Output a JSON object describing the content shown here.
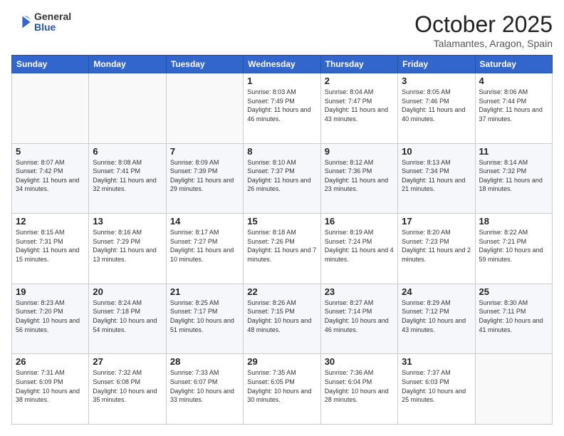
{
  "header": {
    "logo_general": "General",
    "logo_blue": "Blue",
    "month": "October 2025",
    "location": "Talamantes, Aragon, Spain"
  },
  "days_of_week": [
    "Sunday",
    "Monday",
    "Tuesday",
    "Wednesday",
    "Thursday",
    "Friday",
    "Saturday"
  ],
  "weeks": [
    [
      {
        "day": "",
        "info": ""
      },
      {
        "day": "",
        "info": ""
      },
      {
        "day": "",
        "info": ""
      },
      {
        "day": "1",
        "info": "Sunrise: 8:03 AM\nSunset: 7:49 PM\nDaylight: 11 hours and 46 minutes."
      },
      {
        "day": "2",
        "info": "Sunrise: 8:04 AM\nSunset: 7:47 PM\nDaylight: 11 hours and 43 minutes."
      },
      {
        "day": "3",
        "info": "Sunrise: 8:05 AM\nSunset: 7:46 PM\nDaylight: 11 hours and 40 minutes."
      },
      {
        "day": "4",
        "info": "Sunrise: 8:06 AM\nSunset: 7:44 PM\nDaylight: 11 hours and 37 minutes."
      }
    ],
    [
      {
        "day": "5",
        "info": "Sunrise: 8:07 AM\nSunset: 7:42 PM\nDaylight: 11 hours and 34 minutes."
      },
      {
        "day": "6",
        "info": "Sunrise: 8:08 AM\nSunset: 7:41 PM\nDaylight: 11 hours and 32 minutes."
      },
      {
        "day": "7",
        "info": "Sunrise: 8:09 AM\nSunset: 7:39 PM\nDaylight: 11 hours and 29 minutes."
      },
      {
        "day": "8",
        "info": "Sunrise: 8:10 AM\nSunset: 7:37 PM\nDaylight: 11 hours and 26 minutes."
      },
      {
        "day": "9",
        "info": "Sunrise: 8:12 AM\nSunset: 7:36 PM\nDaylight: 11 hours and 23 minutes."
      },
      {
        "day": "10",
        "info": "Sunrise: 8:13 AM\nSunset: 7:34 PM\nDaylight: 11 hours and 21 minutes."
      },
      {
        "day": "11",
        "info": "Sunrise: 8:14 AM\nSunset: 7:32 PM\nDaylight: 11 hours and 18 minutes."
      }
    ],
    [
      {
        "day": "12",
        "info": "Sunrise: 8:15 AM\nSunset: 7:31 PM\nDaylight: 11 hours and 15 minutes."
      },
      {
        "day": "13",
        "info": "Sunrise: 8:16 AM\nSunset: 7:29 PM\nDaylight: 11 hours and 13 minutes."
      },
      {
        "day": "14",
        "info": "Sunrise: 8:17 AM\nSunset: 7:27 PM\nDaylight: 11 hours and 10 minutes."
      },
      {
        "day": "15",
        "info": "Sunrise: 8:18 AM\nSunset: 7:26 PM\nDaylight: 11 hours and 7 minutes."
      },
      {
        "day": "16",
        "info": "Sunrise: 8:19 AM\nSunset: 7:24 PM\nDaylight: 11 hours and 4 minutes."
      },
      {
        "day": "17",
        "info": "Sunrise: 8:20 AM\nSunset: 7:23 PM\nDaylight: 11 hours and 2 minutes."
      },
      {
        "day": "18",
        "info": "Sunrise: 8:22 AM\nSunset: 7:21 PM\nDaylight: 10 hours and 59 minutes."
      }
    ],
    [
      {
        "day": "19",
        "info": "Sunrise: 8:23 AM\nSunset: 7:20 PM\nDaylight: 10 hours and 56 minutes."
      },
      {
        "day": "20",
        "info": "Sunrise: 8:24 AM\nSunset: 7:18 PM\nDaylight: 10 hours and 54 minutes."
      },
      {
        "day": "21",
        "info": "Sunrise: 8:25 AM\nSunset: 7:17 PM\nDaylight: 10 hours and 51 minutes."
      },
      {
        "day": "22",
        "info": "Sunrise: 8:26 AM\nSunset: 7:15 PM\nDaylight: 10 hours and 48 minutes."
      },
      {
        "day": "23",
        "info": "Sunrise: 8:27 AM\nSunset: 7:14 PM\nDaylight: 10 hours and 46 minutes."
      },
      {
        "day": "24",
        "info": "Sunrise: 8:29 AM\nSunset: 7:12 PM\nDaylight: 10 hours and 43 minutes."
      },
      {
        "day": "25",
        "info": "Sunrise: 8:30 AM\nSunset: 7:11 PM\nDaylight: 10 hours and 41 minutes."
      }
    ],
    [
      {
        "day": "26",
        "info": "Sunrise: 7:31 AM\nSunset: 6:09 PM\nDaylight: 10 hours and 38 minutes."
      },
      {
        "day": "27",
        "info": "Sunrise: 7:32 AM\nSunset: 6:08 PM\nDaylight: 10 hours and 35 minutes."
      },
      {
        "day": "28",
        "info": "Sunrise: 7:33 AM\nSunset: 6:07 PM\nDaylight: 10 hours and 33 minutes."
      },
      {
        "day": "29",
        "info": "Sunrise: 7:35 AM\nSunset: 6:05 PM\nDaylight: 10 hours and 30 minutes."
      },
      {
        "day": "30",
        "info": "Sunrise: 7:36 AM\nSunset: 6:04 PM\nDaylight: 10 hours and 28 minutes."
      },
      {
        "day": "31",
        "info": "Sunrise: 7:37 AM\nSunset: 6:03 PM\nDaylight: 10 hours and 25 minutes."
      },
      {
        "day": "",
        "info": ""
      }
    ]
  ]
}
